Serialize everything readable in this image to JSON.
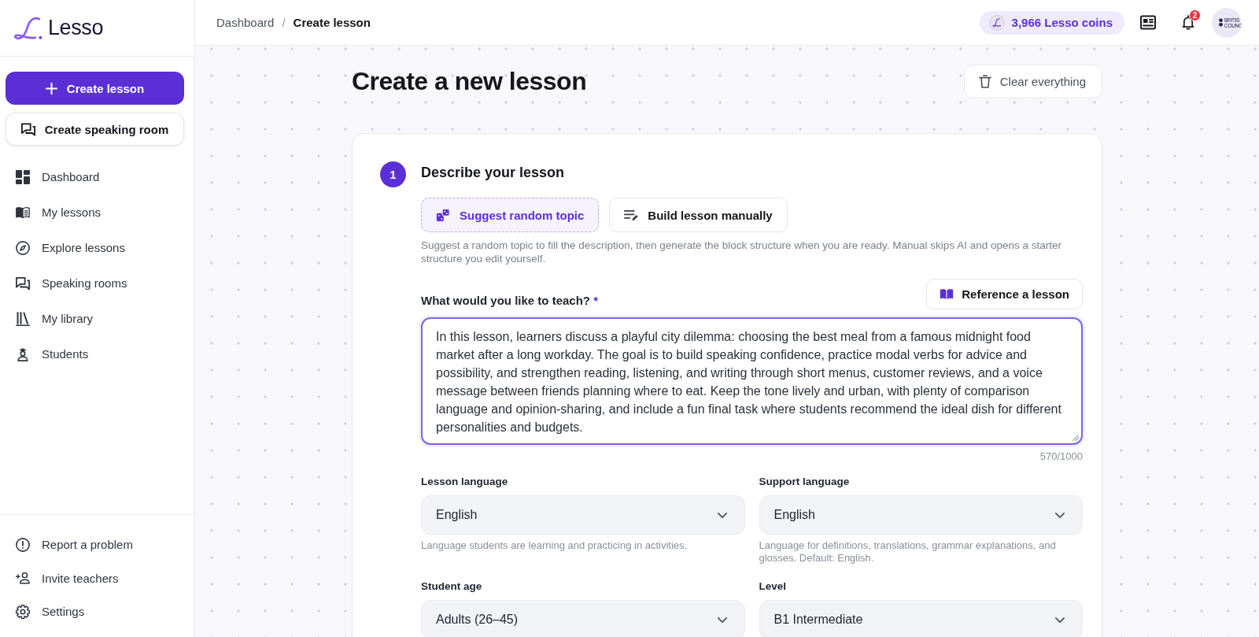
{
  "sidebar": {
    "logo": {
      "name": "Lesso"
    },
    "primary_button": {
      "label": "Create lesson"
    },
    "secondary_button": {
      "label": "Create speaking room"
    },
    "nav_items": [
      {
        "label": "Dashboard",
        "selected": false
      },
      {
        "label": "My lessons",
        "selected": false
      },
      {
        "label": "Explore lessons",
        "selected": false
      },
      {
        "label": "Speaking rooms",
        "selected": false
      },
      {
        "label": "My library",
        "selected": false
      },
      {
        "label": "Students",
        "selected": false
      }
    ],
    "footer_items": [
      {
        "label": "Report a problem"
      },
      {
        "label": "Invite teachers"
      },
      {
        "label": "Settings"
      }
    ]
  },
  "top_bar": {
    "breadcrumb": {
      "separator": "/",
      "items": [
        {
          "label": "Dashboard",
          "current": false
        },
        {
          "label": "Create lesson",
          "current": true
        }
      ]
    },
    "coins": {
      "label": "3,966 Lesso coins"
    },
    "notifications": {
      "count": "2"
    },
    "avatar": {
      "lines": [
        "BRITIS",
        "COUNC"
      ]
    }
  },
  "page": {
    "title": "Create a new lesson",
    "clear_button": {
      "label": "Clear everything"
    }
  },
  "step": {
    "number": "1",
    "title": "Describe your lesson",
    "actions": [
      {
        "label": "Suggest random topic",
        "kind": "suggest"
      },
      {
        "label": "Build lesson manually",
        "kind": "manual"
      }
    ],
    "hint": "Suggest a random topic to fill the description, then generate the block structure when you are ready. Manual skips AI and opens a starter structure you edit yourself.",
    "reference_button": {
      "label": "Reference a lesson"
    },
    "description": {
      "label": "What would you like to teach?",
      "required_mark": "*",
      "value": "In this lesson, learners discuss a playful city dilemma: choosing the best meal from a famous midnight food market after a long workday. The goal is to build speaking confidence, practice modal verbs for advice and possibility, and strengthen reading, listening, and writing through short menus, customer reviews, and a voice message between friends planning where to eat. Keep the tone lively and urban, with plenty of comparison language and opinion-sharing, and include a fun final task where students recommend the ideal dish for different personalities and budgets.",
      "counter": "570/1000"
    },
    "selects": [
      {
        "label": "Lesson language",
        "value": "English",
        "hint": "Language students are learning and practicing in activities."
      },
      {
        "label": "Support language",
        "value": "English",
        "hint": "Language for definitions, translations, grammar explanations, and glosses. Default: English."
      },
      {
        "label": "Student age",
        "value": "Adults (26–45)"
      },
      {
        "label": "Level",
        "value": "B1 Intermediate"
      }
    ]
  }
}
